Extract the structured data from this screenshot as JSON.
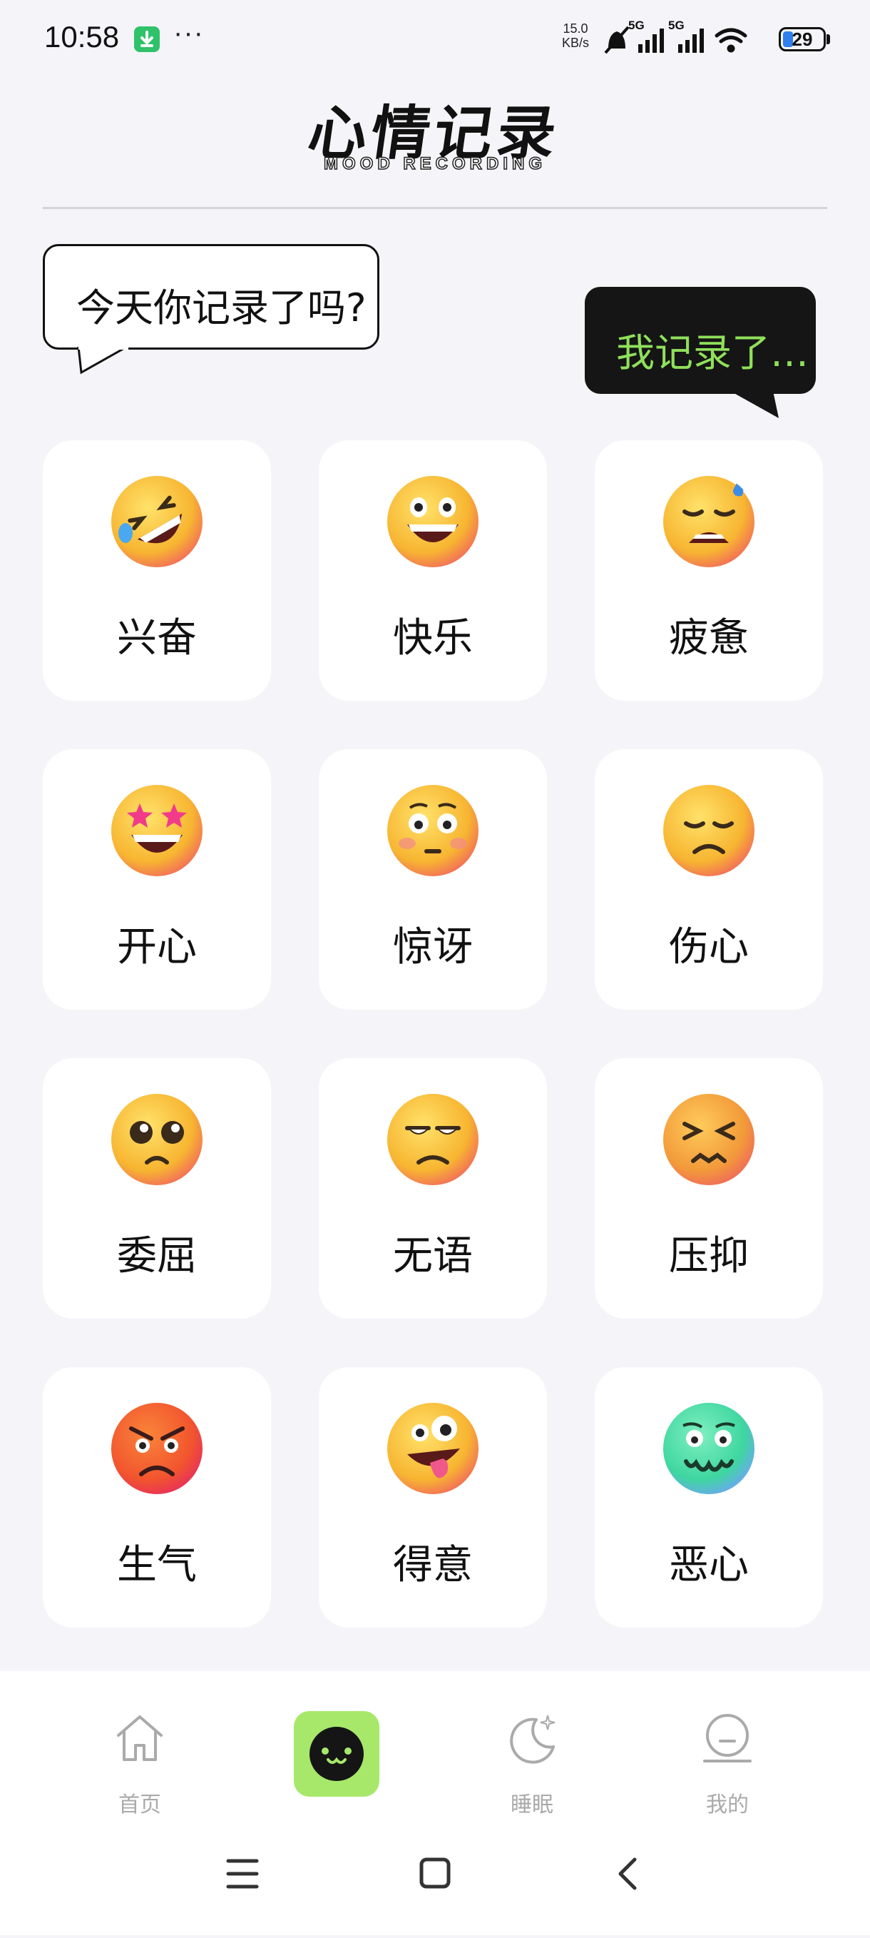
{
  "status_bar": {
    "time": "10:58",
    "dots": "···",
    "speed_value": "15.0",
    "speed_unit": "KB/s",
    "network_1": "5G",
    "network_2": "5G",
    "battery": "29"
  },
  "header": {
    "title": "心情记录",
    "subtitle": "MOOD RECORDING"
  },
  "bubbles": {
    "question": "今天你记录了吗?",
    "answer": "我记录了…"
  },
  "moods": [
    {
      "label": "兴奋",
      "icon": "rofl-emoji-icon",
      "color": "#f7b531"
    },
    {
      "label": "快乐",
      "icon": "grinning-emoji-icon",
      "color": "#f7b531"
    },
    {
      "label": "疲惫",
      "icon": "tired-sweat-emoji-icon",
      "color": "#f7b531"
    },
    {
      "label": "开心",
      "icon": "star-struck-emoji-icon",
      "color": "#f7b531"
    },
    {
      "label": "惊讶",
      "icon": "flushed-emoji-icon",
      "color": "#f7b531"
    },
    {
      "label": "伤心",
      "icon": "sad-emoji-icon",
      "color": "#f7b531"
    },
    {
      "label": "委屈",
      "icon": "pleading-emoji-icon",
      "color": "#f7b531"
    },
    {
      "label": "无语",
      "icon": "unamused-emoji-icon",
      "color": "#f7b531"
    },
    {
      "label": "压抑",
      "icon": "confounded-emoji-icon",
      "color": "#f29a3a"
    },
    {
      "label": "生气",
      "icon": "angry-emoji-icon",
      "color": "#f2552e"
    },
    {
      "label": "得意",
      "icon": "zany-emoji-icon",
      "color": "#f7b531"
    },
    {
      "label": "恶心",
      "icon": "nauseated-emoji-icon",
      "color": "#3fd6a0"
    }
  ],
  "tabs": [
    {
      "label": "首页",
      "icon": "home-icon"
    },
    {
      "label": "",
      "icon": "mood-face-icon"
    },
    {
      "label": "睡眠",
      "icon": "moon-icon"
    },
    {
      "label": "我的",
      "icon": "profile-icon"
    }
  ],
  "accent_color": "#a7e86a"
}
